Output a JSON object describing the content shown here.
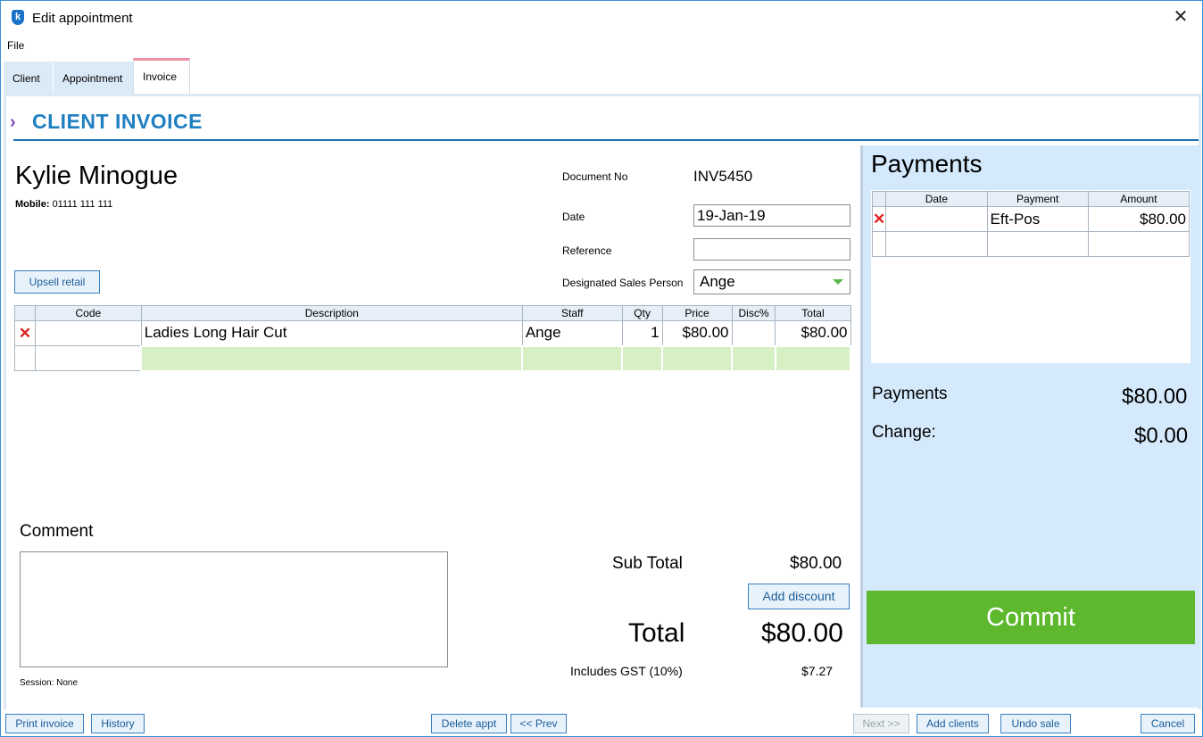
{
  "window": {
    "title": "Edit appointment",
    "logo_letter": "k",
    "close_glyph": "✕"
  },
  "menu": {
    "file": "File"
  },
  "tabs": [
    {
      "label": "Client"
    },
    {
      "label": "Appointment"
    },
    {
      "label": "Invoice"
    }
  ],
  "header": {
    "chevrons": "»»»",
    "title": "CLIENT INVOICE"
  },
  "client": {
    "name": "Kylie Minogue",
    "mobile_label": "Mobile:",
    "mobile": "01111 111 111"
  },
  "fields": {
    "document_no_label": "Document No",
    "document_no": "INV5450",
    "date_label": "Date",
    "date": "19-Jan-19",
    "reference_label": "Reference",
    "reference": "",
    "sales_person_label": "Designated Sales Person",
    "sales_person": "Ange"
  },
  "buttons": {
    "upsell": "Upsell retail",
    "add_discount": "Add discount",
    "commit": "Commit",
    "print_invoice": "Print invoice",
    "history": "History",
    "delete_appt": "Delete appt",
    "prev": "<< Prev",
    "next": "Next >>",
    "add_clients": "Add clients",
    "undo_sale": "Undo sale",
    "cancel": "Cancel"
  },
  "items": {
    "columns": [
      "Code",
      "Description",
      "Staff",
      "Qty",
      "Price",
      "Disc%",
      "Total"
    ],
    "rows": [
      {
        "code": "",
        "description": "Ladies Long Hair Cut",
        "staff": "Ange",
        "qty": "1",
        "price": "$80.00",
        "disc": "",
        "total": "$80.00"
      }
    ]
  },
  "comment": {
    "label": "Comment",
    "value": "",
    "session": "Session: None"
  },
  "totals": {
    "sub_total_label": "Sub Total",
    "sub_total": "$80.00",
    "total_label": "Total",
    "total": "$80.00",
    "gst_label": "Includes GST (10%)",
    "gst": "$7.27"
  },
  "payments": {
    "title": "Payments",
    "columns": [
      "Date",
      "Payment",
      "Amount"
    ],
    "rows": [
      {
        "date": "",
        "payment": "Eft-Pos",
        "amount": "$80.00"
      }
    ],
    "payments_label": "Payments",
    "payments_total": "$80.00",
    "change_label": "Change:",
    "change": "$0.00"
  },
  "colors": {
    "accent": "#1f7fc1",
    "commit": "#5db82e",
    "delete": "#e02020",
    "panel": "#d4e9fb"
  }
}
